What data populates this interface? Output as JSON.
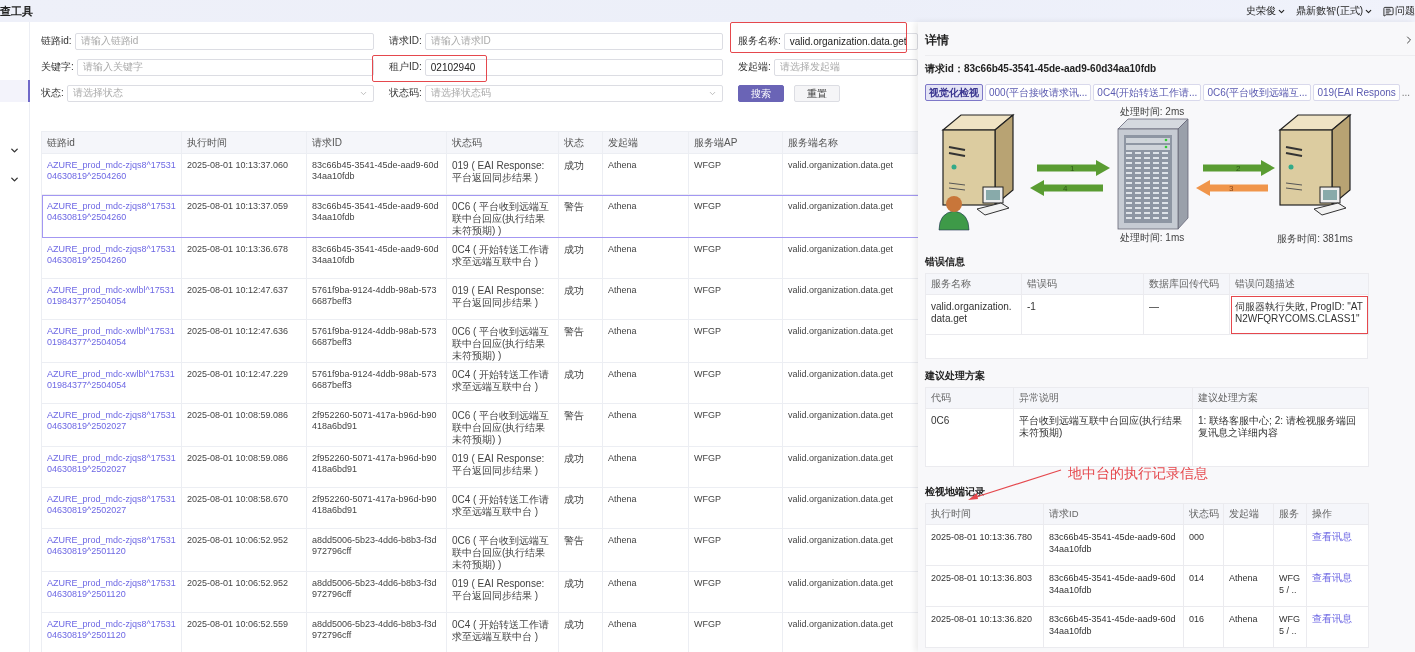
{
  "app": {
    "title": "查工具",
    "user": "史荣俊",
    "org": "鼎新數智(正式)",
    "help": "问题"
  },
  "filters": [
    {
      "label": "链路id:",
      "placeholder": "请输入链路id",
      "kind": "input",
      "highlighted": false
    },
    {
      "label": "请求ID:",
      "placeholder": "请输入请求ID",
      "kind": "input",
      "highlighted": false
    },
    {
      "label": "服务名称:",
      "value": "valid.organization.data.get",
      "kind": "input",
      "highlighted": true
    },
    {
      "label": "关键字:",
      "placeholder": "请输入关键字",
      "kind": "input",
      "highlighted": false
    },
    {
      "label": "租户ID:",
      "value": "02102940",
      "kind": "input",
      "highlighted": true
    },
    {
      "label": "发起端:",
      "placeholder": "请选择发起端",
      "kind": "input",
      "highlighted": false
    },
    {
      "label": "状态:",
      "placeholder": "请选择状态",
      "kind": "select",
      "highlighted": false
    },
    {
      "label": "状态码:",
      "placeholder": "请选择状态码",
      "kind": "select",
      "highlighted": false
    }
  ],
  "buttons": [
    {
      "label": "搜索",
      "primary": true
    },
    {
      "label": "重置",
      "primary": false
    }
  ],
  "table": {
    "columns": [
      "链路id",
      "执行时间",
      "请求ID",
      "状态码",
      "状态",
      "发起端",
      "服务端AP",
      "服务端名称"
    ],
    "rows": [
      {
        "trace_id": "AZURE_prod_mdc-zjqs8^1753104630819^2504260",
        "time": "2025-08-01 10:13:37.060",
        "request_id": "83c66b45-3541-45de-aad9-60d34aa10fdb",
        "status_code": "019 ( EAI Response:平台返回同步结果 )",
        "status": "成功",
        "origin": "Athena",
        "server_ap": "WFGP",
        "service": "valid.organization.data.get",
        "selected": false
      },
      {
        "trace_id": "AZURE_prod_mdc-zjqs8^1753104630819^2504260",
        "time": "2025-08-01 10:13:37.059",
        "request_id": "83c66b45-3541-45de-aad9-60d34aa10fdb",
        "status_code": "0C6 ( 平台收到远端互联中台回应(执行结果未符预期) )",
        "status": "警告",
        "origin": "Athena",
        "server_ap": "WFGP",
        "service": "valid.organization.data.get",
        "selected": true
      },
      {
        "trace_id": "AZURE_prod_mdc-zjqs8^1753104630819^2504260",
        "time": "2025-08-01 10:13:36.678",
        "request_id": "83c66b45-3541-45de-aad9-60d34aa10fdb",
        "status_code": "0C4 ( 开始转送工作请求至远端互联中台 )",
        "status": "成功",
        "origin": "Athena",
        "server_ap": "WFGP",
        "service": "valid.organization.data.get",
        "selected": false
      },
      {
        "trace_id": "AZURE_prod_mdc-xwlbl^1753101984377^2504054",
        "time": "2025-08-01 10:12:47.637",
        "request_id": "5761f9ba-9124-4ddb-98ab-5736687beff3",
        "status_code": "019 ( EAI Response:平台返回同步结果 )",
        "status": "成功",
        "origin": "Athena",
        "server_ap": "WFGP",
        "service": "valid.organization.data.get",
        "selected": false
      },
      {
        "trace_id": "AZURE_prod_mdc-xwlbl^1753101984377^2504054",
        "time": "2025-08-01 10:12:47.636",
        "request_id": "5761f9ba-9124-4ddb-98ab-5736687beff3",
        "status_code": "0C6 ( 平台收到远端互联中台回应(执行结果未符预期) )",
        "status": "警告",
        "origin": "Athena",
        "server_ap": "WFGP",
        "service": "valid.organization.data.get",
        "selected": false
      },
      {
        "trace_id": "AZURE_prod_mdc-xwlbl^1753101984377^2504054",
        "time": "2025-08-01 10:12:47.229",
        "request_id": "5761f9ba-9124-4ddb-98ab-5736687beff3",
        "status_code": "0C4 ( 开始转送工作请求至远端互联中台 )",
        "status": "成功",
        "origin": "Athena",
        "server_ap": "WFGP",
        "service": "valid.organization.data.get",
        "selected": false
      },
      {
        "trace_id": "AZURE_prod_mdc-zjqs8^1753104630819^2502027",
        "time": "2025-08-01 10:08:59.086",
        "request_id": "2f952260-5071-417a-b96d-b90418a6bd91",
        "status_code": "0C6 ( 平台收到远端互联中台回应(执行结果未符预期) )",
        "status": "警告",
        "origin": "Athena",
        "server_ap": "WFGP",
        "service": "valid.organization.data.get",
        "selected": false
      },
      {
        "trace_id": "AZURE_prod_mdc-zjqs8^1753104630819^2502027",
        "time": "2025-08-01 10:08:59.086",
        "request_id": "2f952260-5071-417a-b96d-b90418a6bd91",
        "status_code": "019 ( EAI Response:平台返回同步结果 )",
        "status": "成功",
        "origin": "Athena",
        "server_ap": "WFGP",
        "service": "valid.organization.data.get",
        "selected": false
      },
      {
        "trace_id": "AZURE_prod_mdc-zjqs8^1753104630819^2502027",
        "time": "2025-08-01 10:08:58.670",
        "request_id": "2f952260-5071-417a-b96d-b90418a6bd91",
        "status_code": "0C4 ( 开始转送工作请求至远端互联中台 )",
        "status": "成功",
        "origin": "Athena",
        "server_ap": "WFGP",
        "service": "valid.organization.data.get",
        "selected": false
      },
      {
        "trace_id": "AZURE_prod_mdc-zjqs8^1753104630819^2501120",
        "time": "2025-08-01 10:06:52.952",
        "request_id": "a8dd5006-5b23-4dd6-b8b3-f3d972796cff",
        "status_code": "0C6 ( 平台收到远端互联中台回应(执行结果未符预期) )",
        "status": "警告",
        "origin": "Athena",
        "server_ap": "WFGP",
        "service": "valid.organization.data.get",
        "selected": false
      },
      {
        "trace_id": "AZURE_prod_mdc-zjqs8^1753104630819^2501120",
        "time": "2025-08-01 10:06:52.952",
        "request_id": "a8dd5006-5b23-4dd6-b8b3-f3d972796cff",
        "status_code": "019 ( EAI Response:平台返回同步结果 )",
        "status": "成功",
        "origin": "Athena",
        "server_ap": "WFGP",
        "service": "valid.organization.data.get",
        "selected": false
      },
      {
        "trace_id": "AZURE_prod_mdc-zjqs8^1753104630819^2501120",
        "time": "2025-08-01 10:06:52.559",
        "request_id": "a8dd5006-5b23-4dd6-b8b3-f3d972796cff",
        "status_code": "0C4 ( 开始转送工作请求至远端互联中台 )",
        "status": "成功",
        "origin": "Athena",
        "server_ap": "WFGP",
        "service": "valid.organization.data.get",
        "selected": false
      }
    ]
  },
  "detail": {
    "title": "详情",
    "request_label": "请求id：",
    "request_id": "83c66b45-3541-45de-aad9-60d34aa10fdb",
    "tabs": [
      {
        "label": "视觉化检视",
        "selected": true
      },
      {
        "label": "000(平台接收请求讯...",
        "selected": false
      },
      {
        "label": "0C4(开始转送工作请...",
        "selected": false
      },
      {
        "label": "0C6(平台收到远端互...",
        "selected": false
      },
      {
        "label": "019(EAI Respons",
        "selected": false
      }
    ],
    "more": "...",
    "diagram": {
      "top_time": "处理时间: 2ms",
      "bottom_time": "处理时间: 1ms",
      "service_time": "服务时间: 381ms",
      "steps": [
        "1",
        "2",
        "3",
        "4"
      ]
    },
    "error": {
      "title": "错误信息",
      "columns": [
        "服务名称",
        "错误码",
        "数据库回传代码",
        "错误问题描述"
      ],
      "rows": [
        {
          "cells": [
            "valid.organization.data.get",
            "-1",
            "—",
            "伺服器執行失敗, ProgID: \"ATN2WFQRYCOMS.CLASS1\""
          ],
          "highlighted": true
        }
      ]
    },
    "suggestion": {
      "title": "建议处理方案",
      "columns": [
        "代码",
        "异常说明",
        "建议处理方案"
      ],
      "rows": [
        [
          "0C6",
          "平台收到远端互联中台回应(执行结果未符预期)",
          "1: 联络客服中心; 2: 请检视服务端回复讯息之详细内容"
        ]
      ]
    },
    "records": {
      "title": "检视地端记录",
      "columns": [
        "执行时间",
        "请求ID",
        "状态码",
        "发起端",
        "服务",
        "操作"
      ],
      "rows": [
        {
          "time": "2025-08-01 10:13:36.780",
          "request_id": "83c66b45-3541-45de-aad9-60d34aa10fdb",
          "code": "000",
          "origin": "",
          "server": "",
          "action": "查看讯息"
        },
        {
          "time": "2025-08-01 10:13:36.803",
          "request_id": "83c66b45-3541-45de-aad9-60d34aa10fdb",
          "code": "014",
          "origin": "Athena",
          "server": "WFG 5 / ..",
          "action": "查看讯息"
        },
        {
          "time": "2025-08-01 10:13:36.820",
          "request_id": "83c66b45-3541-45de-aad9-60d34aa10fdb",
          "code": "016",
          "origin": "Athena",
          "server": "WFG 5 / ..",
          "action": "查看讯息"
        }
      ]
    }
  },
  "annotation": {
    "text": "地中台的执行记录信息"
  }
}
